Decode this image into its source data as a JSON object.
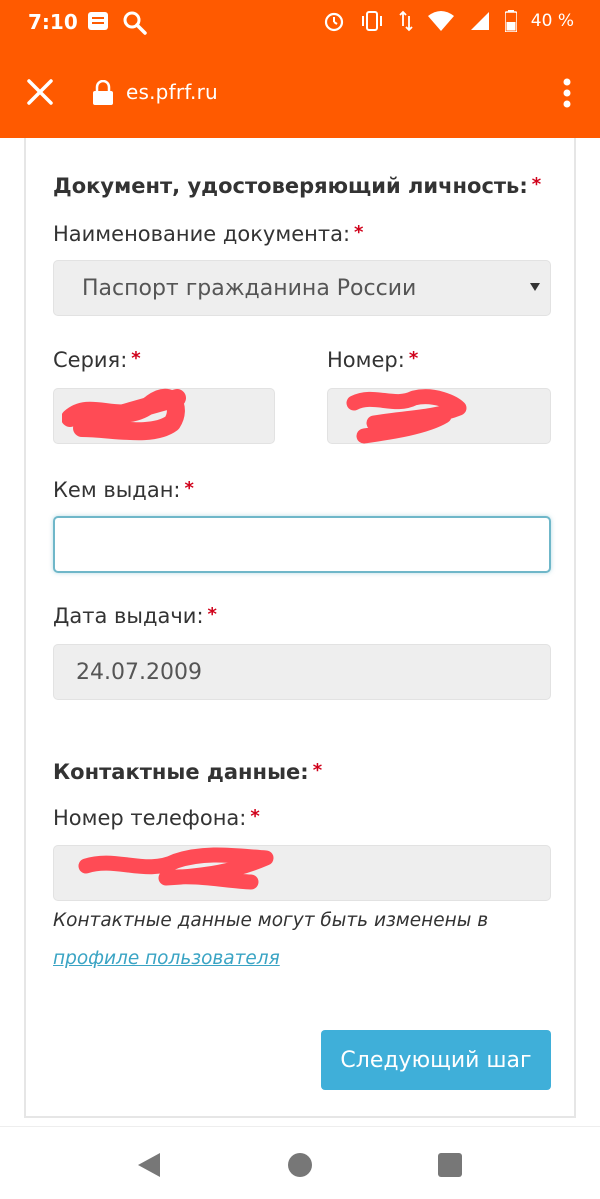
{
  "status_bar": {
    "time": "7:10",
    "battery": "40 %",
    "icons_left": [
      "notes-icon",
      "search-icon"
    ],
    "icons_right": [
      "alarm-icon",
      "vibrate-icon",
      "data-transfer-icon",
      "wifi-icon",
      "signal-icon",
      "battery-icon"
    ]
  },
  "browser": {
    "url": "es.pfrf.ru"
  },
  "form": {
    "document_section": {
      "title": "Документ, удостоверяющий личность:",
      "required_mark": "*",
      "doc_name_label": "Наименование документа:",
      "doc_name_value": "Паспорт гражданина России",
      "series_label": "Серия:",
      "number_label": "Номер:",
      "issued_by_label": "Кем выдан:",
      "issued_by_value": "",
      "issue_date_label": "Дата выдачи:",
      "issue_date_value": "24.07.2009"
    },
    "contact_section": {
      "title": "Контактные данные:",
      "phone_label": "Номер телефона:",
      "note_text": "Контактные данные могут быть изменены в",
      "note_link": "профиле пользователя"
    },
    "next_button": "Следующий шаг"
  },
  "colors": {
    "toolbar": "#ff5a00",
    "required": "#d0021b",
    "button": "#3fafd9",
    "link": "#3aa4c4",
    "redaction": "#ff4b55"
  }
}
